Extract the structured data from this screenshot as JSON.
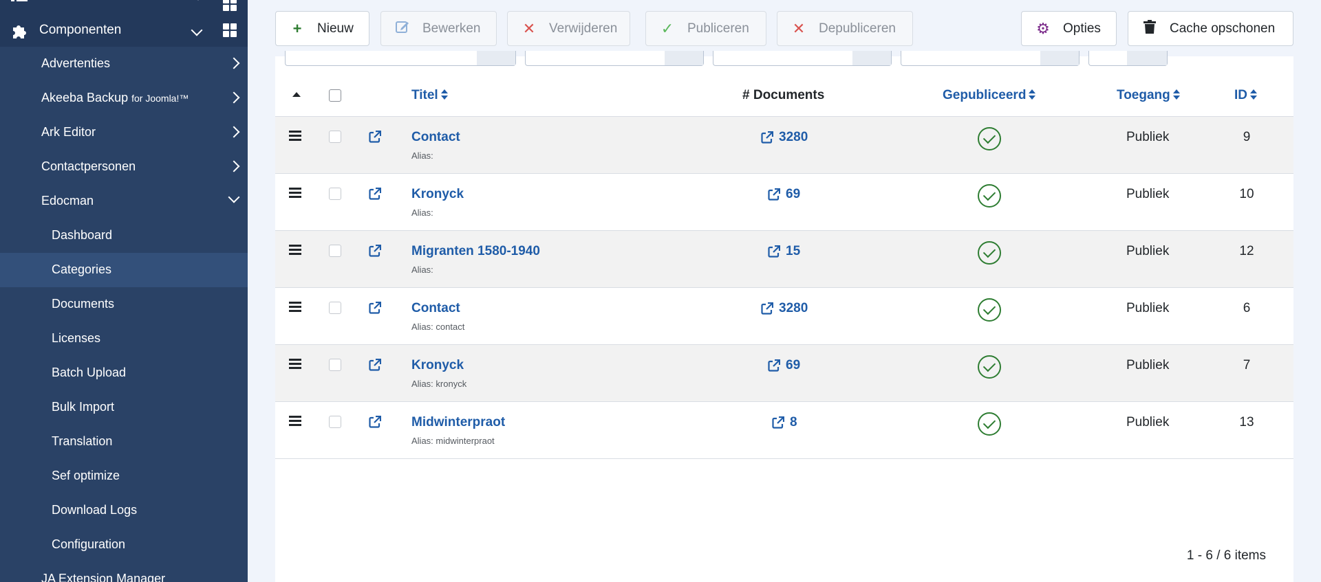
{
  "sidebar": {
    "components_label": "Componenten",
    "items": [
      {
        "label": "Advertenties"
      },
      {
        "label": "Akeeba Backup",
        "suffix": "for Joomla!™"
      },
      {
        "label": "Ark Editor"
      },
      {
        "label": "Contactpersonen"
      },
      {
        "label": "Edocman"
      },
      {
        "label": "Dashboard"
      },
      {
        "label": "Categories"
      },
      {
        "label": "Documents"
      },
      {
        "label": "Licenses"
      },
      {
        "label": "Batch Upload"
      },
      {
        "label": "Bulk Import"
      },
      {
        "label": "Translation"
      },
      {
        "label": "Sef optimize"
      },
      {
        "label": "Download Logs"
      },
      {
        "label": "Configuration"
      },
      {
        "label": "JA Extension Manager"
      }
    ]
  },
  "toolbar": {
    "new_label": "Nieuw",
    "edit_label": "Bewerken",
    "delete_label": "Verwijderen",
    "publish_label": "Publiceren",
    "unpublish_label": "Depubliceren",
    "options_label": "Opties",
    "clear_cache_label": "Cache opschonen"
  },
  "table": {
    "headers": {
      "title": "Titel",
      "documents": "# Documents",
      "published": "Gepubliceerd",
      "access": "Toegang",
      "id": "ID"
    },
    "rows": [
      {
        "title": "Contact",
        "alias": "Alias:",
        "documents": "3280",
        "access": "Publiek",
        "id": "9"
      },
      {
        "title": "Kronyck",
        "alias": "Alias:",
        "documents": "69",
        "access": "Publiek",
        "id": "10"
      },
      {
        "title": "Migranten 1580-1940",
        "alias": "Alias:",
        "documents": "15",
        "access": "Publiek",
        "id": "12"
      },
      {
        "title": "Contact",
        "alias": "Alias: contact",
        "documents": "3280",
        "access": "Publiek",
        "id": "6"
      },
      {
        "title": "Kronyck",
        "alias": "Alias: kronyck",
        "documents": "69",
        "access": "Publiek",
        "id": "7"
      },
      {
        "title": "Midwinterpraot",
        "alias": "Alias: midwinterpraot",
        "documents": "8",
        "access": "Publiek",
        "id": "13"
      }
    ]
  },
  "pagination": {
    "summary": "1 - 6 / 6 items"
  },
  "colors": {
    "sidebar": "#23395b",
    "link": "#1f5ca8",
    "published": "#2e7d32"
  }
}
